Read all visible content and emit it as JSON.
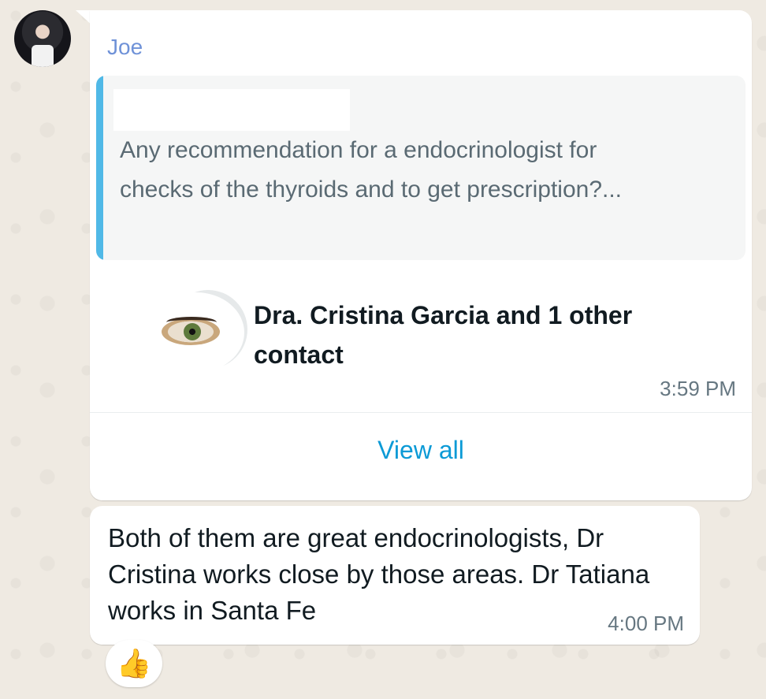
{
  "message1": {
    "sender": "Joe",
    "quoted_text": "Any recommendation for a endocrinologist for checks of the thyroids and to get prescription?...",
    "contact_card": {
      "title": "Dra. Cristina Garcia and 1 other contact",
      "time": "3:59 PM",
      "view_all_label": "View all"
    }
  },
  "message2": {
    "text": "Both of them are great endocrinologists, Dr Cristina works close by those areas. Dr Tatiana works in Santa Fe",
    "time": "4:00 PM",
    "reaction": "👍"
  },
  "colors": {
    "background": "#efeae2",
    "sender_name": "#6f92d8",
    "quote_bar": "#50b9e7",
    "link": "#0b9ad6"
  }
}
